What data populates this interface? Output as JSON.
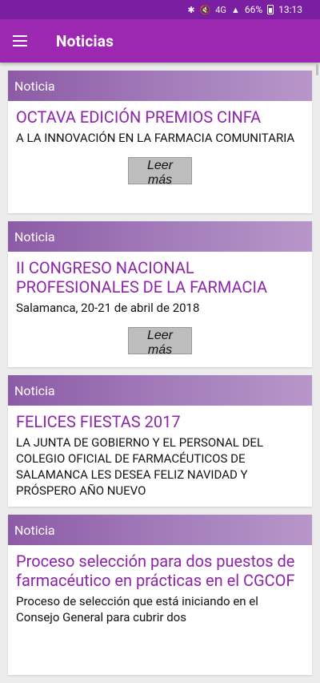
{
  "status": {
    "battery": "66%",
    "time": "13:13",
    "network": "4G"
  },
  "app_bar": {
    "title": "Noticias"
  },
  "cards": [
    {
      "header": "Noticia",
      "title": "OCTAVA EDICIÓN PREMIOS CINFA",
      "subtitle": "A LA INNOVACIÓN EN LA FARMACIA COMUNITARIA",
      "button": "Leer más"
    },
    {
      "header": "Noticia",
      "title": "II CONGRESO NACIONAL PROFESIONALES DE LA FARMACIA",
      "subtitle": "Salamanca, 20-21 de abril de 2018",
      "button": "Leer más"
    },
    {
      "header": "Noticia",
      "title": "FELICES FIESTAS 2017",
      "subtitle": "LA JUNTA DE GOBIERNO Y EL PERSONAL DEL COLEGIO OFICIAL DE FARMACÉUTICOS DE SALAMANCA LES DESEA FELIZ NAVIDAD Y PRÓSPERO AÑO NUEVO"
    },
    {
      "header": "Noticia",
      "title": "Proceso selección para dos puestos de farmacéutico en prácticas en el CGCOF",
      "subtitle": "Proceso de selección que está iniciando en el Consejo General para cubrir dos"
    }
  ]
}
